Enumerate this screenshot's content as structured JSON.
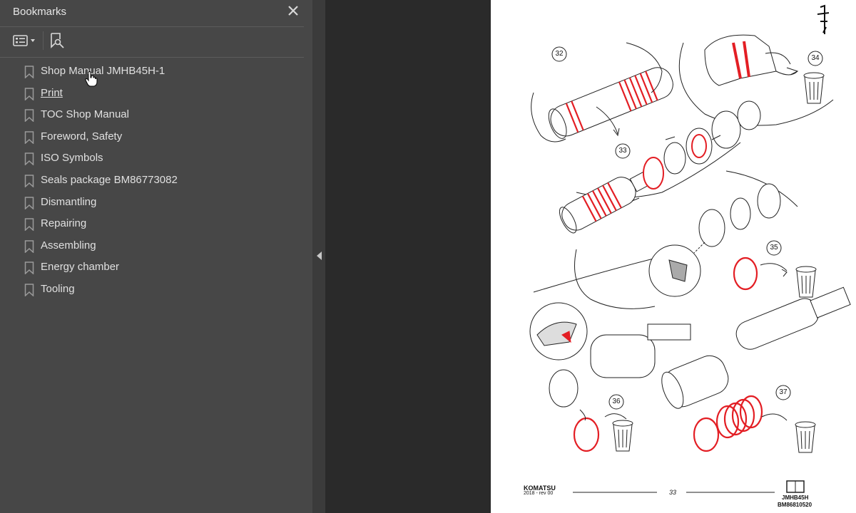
{
  "panel": {
    "title": "Bookmarks",
    "close_icon": "close-icon",
    "options_icon": "bookmark-options-icon",
    "find_icon": "find-bookmark-icon"
  },
  "bookmarks": [
    {
      "label": "Shop Manual JMHB45H-1",
      "link": false
    },
    {
      "label": "Print",
      "link": true
    },
    {
      "label": "TOC Shop Manual",
      "link": false
    },
    {
      "label": "Foreword, Safety",
      "link": false
    },
    {
      "label": "ISO Symbols",
      "link": false
    },
    {
      "label": "Seals package BM86773082",
      "link": false
    },
    {
      "label": "Dismantling",
      "link": false
    },
    {
      "label": "Repairing",
      "link": false
    },
    {
      "label": "Assembling",
      "link": false
    },
    {
      "label": "Energy chamber",
      "link": false
    },
    {
      "label": "Tooling",
      "link": false
    }
  ],
  "document": {
    "callouts": [
      "32",
      "33",
      "34",
      "35",
      "36",
      "37"
    ],
    "footer": {
      "brand": "KOMATSU",
      "date": "2018 -  rev 00",
      "page_number": "33",
      "model": "JMHB45H",
      "doc_code": "BM86810520"
    }
  },
  "colors": {
    "panel_bg": "#474747",
    "accent_red": "#e31e24",
    "page_bg": "#ffffff"
  }
}
